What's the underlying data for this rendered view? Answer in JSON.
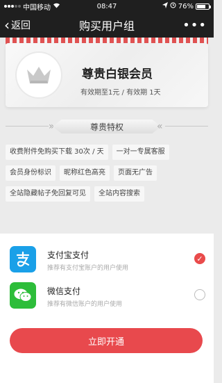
{
  "status_bar": {
    "carrier": "中国移动",
    "wifi_icon": "wifi-icon",
    "time": "08:47",
    "battery_percent": "76%",
    "battery_level": 0.76
  },
  "nav": {
    "back_label": "返回",
    "title": "购买用户组",
    "more_label": "•••"
  },
  "member": {
    "title": "尊贵白银会员",
    "validity": "有效期至1元 / 有效期 1天",
    "icon": "crown-icon"
  },
  "privileges": {
    "header": "尊贵特权",
    "rows": [
      [
        "收费附件免购买下载 30次 / 天",
        "一对一专属客服"
      ],
      [
        "会员身份标识",
        "昵称红色高亮",
        "页面无广告"
      ],
      [
        "全站隐藏帖子免回复可见",
        "全站内容搜索"
      ]
    ]
  },
  "payments": [
    {
      "name": "支付宝支付",
      "desc": "推荐有支付宝账户的用户使用",
      "icon": "alipay-icon",
      "selected": true
    },
    {
      "name": "微信支付",
      "desc": "推荐有微信账户的用户使用",
      "icon": "wechat-icon",
      "selected": false
    }
  ],
  "action": {
    "label": "立即开通"
  },
  "colors": {
    "accent": "#e8494d",
    "alipay": "#1aa0e8",
    "wechat": "#2dbd3a"
  }
}
